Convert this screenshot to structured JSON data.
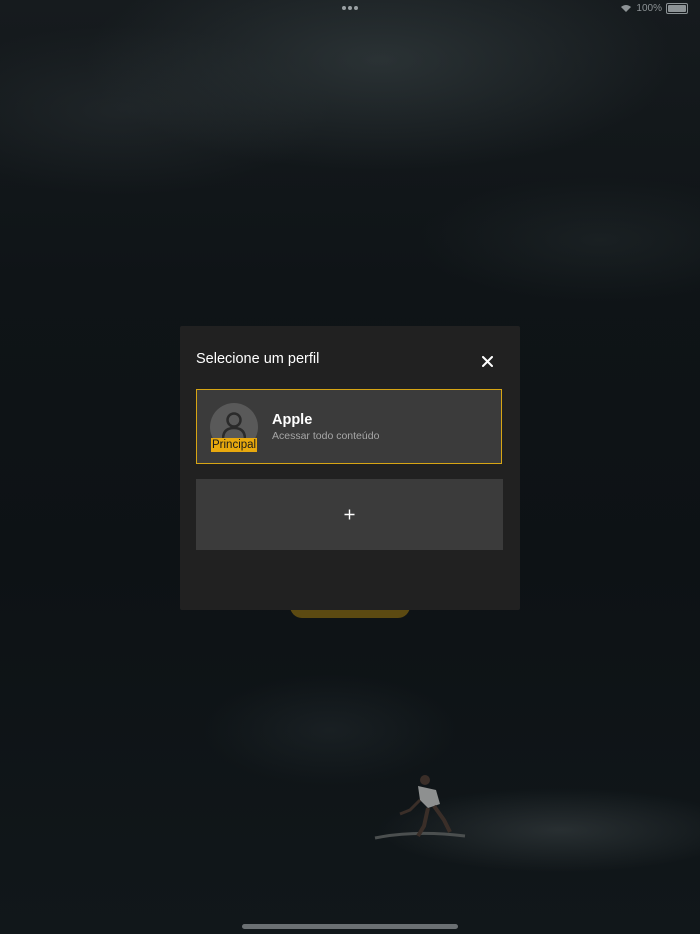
{
  "status_bar": {
    "battery_text": "100%"
  },
  "modal": {
    "title": "Selecione um perfil",
    "profiles": [
      {
        "name": "Apple",
        "subtitle": "Acessar todo conteúdo",
        "badge": "Principal",
        "selected": true
      }
    ],
    "add_profile_icon": "plus-icon",
    "close_icon": "close-icon"
  },
  "colors": {
    "accent": "#e8a90e",
    "modal_bg": "#212121",
    "card_bg": "#3b3b3b",
    "selected_border": "#d7a514"
  }
}
